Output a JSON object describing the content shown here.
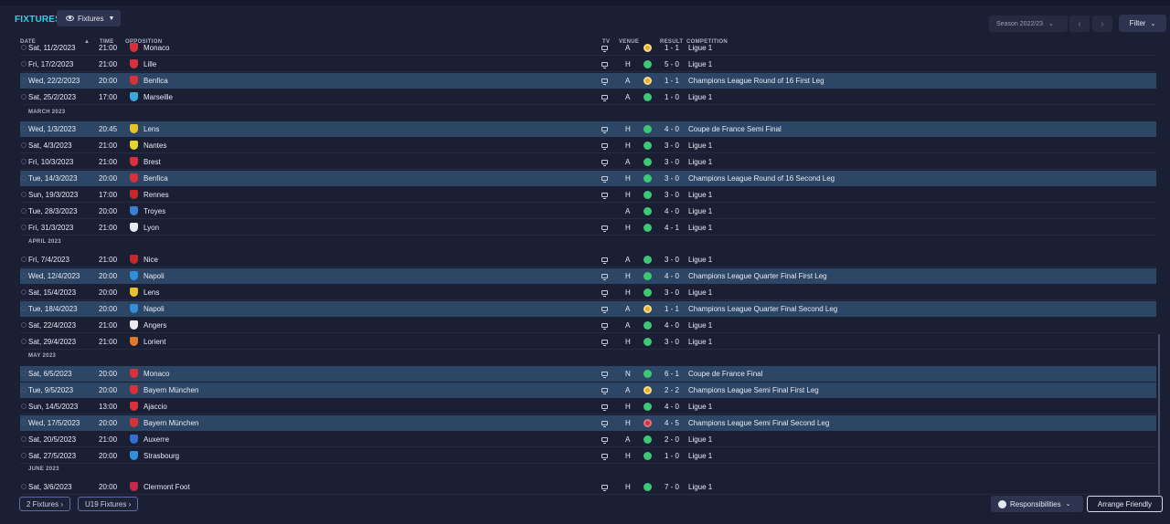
{
  "header": {
    "title": "FIXTURES",
    "view_dropdown": "Fixtures",
    "season": "Season 2022/23",
    "filter_label": "Filter"
  },
  "columns": {
    "date": "DATE",
    "time": "TIME",
    "opposition": "OPPOSITION",
    "tv": "TV",
    "venue": "VENUE",
    "result": "RESULT",
    "competition": "COMPETITION"
  },
  "icons": [
    "eye-icon",
    "chevron-down-icon",
    "chevron-left-icon",
    "chevron-right-icon",
    "sort-arrow-icon",
    "tv-icon",
    "result-dot-icon",
    "club-crest-icon",
    "responsibilities-icon"
  ],
  "colors": {
    "accent": "#2fd1e4",
    "win": "#3ec774",
    "draw": "#e7ad2b",
    "loss": "#c03c42",
    "highlight_row": "#2e4665"
  },
  "months": [
    "MARCH 2023",
    "APRIL 2023",
    "MAY 2023",
    "JUNE 2023"
  ],
  "fixtures": [
    {
      "date": "Sat, 11/2/2023",
      "time": "21:00",
      "opp": "Monaco",
      "crest": "#d8313a",
      "tv": true,
      "venue": "A",
      "result": "1 - 1",
      "outcome": "D",
      "comp": "Ligue 1",
      "hl": false
    },
    {
      "date": "Fri, 17/2/2023",
      "time": "21:00",
      "opp": "Lille",
      "crest": "#d8313a",
      "tv": true,
      "venue": "H",
      "result": "5 - 0",
      "outcome": "W",
      "comp": "Ligue 1",
      "hl": false
    },
    {
      "date": "Wed, 22/2/2023",
      "time": "20:00",
      "opp": "Benfica",
      "crest": "#d8313a",
      "tv": true,
      "venue": "A",
      "result": "1 - 1",
      "outcome": "D",
      "comp": "Champions League Round of 16  First Leg",
      "hl": true
    },
    {
      "date": "Sat, 25/2/2023",
      "time": "17:00",
      "opp": "Marseille",
      "crest": "#3aa7df",
      "tv": true,
      "venue": "A",
      "result": "1 - 0",
      "outcome": "W",
      "comp": "Ligue 1",
      "hl": false
    },
    {
      "date": "Wed, 1/3/2023",
      "time": "20:45",
      "opp": "Lens",
      "crest": "#e8c12b",
      "tv": true,
      "venue": "H",
      "result": "4 - 0",
      "outcome": "W",
      "comp": "Coupe de France Semi Final",
      "hl": true
    },
    {
      "date": "Sat, 4/3/2023",
      "time": "21:00",
      "opp": "Nantes",
      "crest": "#e8d52b",
      "tv": true,
      "venue": "H",
      "result": "3 - 0",
      "outcome": "W",
      "comp": "Ligue 1",
      "hl": false
    },
    {
      "date": "Fri, 10/3/2023",
      "time": "21:00",
      "opp": "Brest",
      "crest": "#d8313a",
      "tv": true,
      "venue": "A",
      "result": "3 - 0",
      "outcome": "W",
      "comp": "Ligue 1",
      "hl": false
    },
    {
      "date": "Tue, 14/3/2023",
      "time": "20:00",
      "opp": "Benfica",
      "crest": "#d8313a",
      "tv": true,
      "venue": "H",
      "result": "3 - 0",
      "outcome": "W",
      "comp": "Champions League Round of 16  Second Leg",
      "hl": true
    },
    {
      "date": "Sun, 19/3/2023",
      "time": "17:00",
      "opp": "Rennes",
      "crest": "#c42a2a",
      "tv": true,
      "venue": "H",
      "result": "3 - 0",
      "outcome": "W",
      "comp": "Ligue 1",
      "hl": false
    },
    {
      "date": "Tue, 28/3/2023",
      "time": "20:00",
      "opp": "Troyes",
      "crest": "#3a7fd0",
      "tv": false,
      "venue": "A",
      "result": "4 - 0",
      "outcome": "W",
      "comp": "Ligue 1",
      "hl": false
    },
    {
      "date": "Fri, 31/3/2023",
      "time": "21:00",
      "opp": "Lyon",
      "crest": "#e9eaf0",
      "tv": true,
      "venue": "H",
      "result": "4 - 1",
      "outcome": "W",
      "comp": "Ligue 1",
      "hl": false
    },
    {
      "date": "Fri, 7/4/2023",
      "time": "21:00",
      "opp": "Nice",
      "crest": "#c42a2a",
      "tv": true,
      "venue": "A",
      "result": "3 - 0",
      "outcome": "W",
      "comp": "Ligue 1",
      "hl": false
    },
    {
      "date": "Wed, 12/4/2023",
      "time": "20:00",
      "opp": "Napoli",
      "crest": "#2f8fd9",
      "tv": true,
      "venue": "H",
      "result": "4 - 0",
      "outcome": "W",
      "comp": "Champions League Quarter Final First Leg",
      "hl": true
    },
    {
      "date": "Sat, 15/4/2023",
      "time": "20:00",
      "opp": "Lens",
      "crest": "#e8c12b",
      "tv": true,
      "venue": "H",
      "result": "3 - 0",
      "outcome": "W",
      "comp": "Ligue 1",
      "hl": false
    },
    {
      "date": "Tue, 18/4/2023",
      "time": "20:00",
      "opp": "Napoli",
      "crest": "#2f8fd9",
      "tv": true,
      "venue": "A",
      "result": "1 - 1",
      "outcome": "D",
      "comp": "Champions League Quarter Final Second Leg",
      "hl": true
    },
    {
      "date": "Sat, 22/4/2023",
      "time": "21:00",
      "opp": "Angers",
      "crest": "#e9eaf0",
      "tv": true,
      "venue": "A",
      "result": "4 - 0",
      "outcome": "W",
      "comp": "Ligue 1",
      "hl": false
    },
    {
      "date": "Sat, 29/4/2023",
      "time": "21:00",
      "opp": "Lorient",
      "crest": "#e07a2a",
      "tv": true,
      "venue": "H",
      "result": "3 - 0",
      "outcome": "W",
      "comp": "Ligue 1",
      "hl": false
    },
    {
      "date": "Sat, 6/5/2023",
      "time": "20:00",
      "opp": "Monaco",
      "crest": "#d8313a",
      "tv": true,
      "venue": "N",
      "result": "6 - 1",
      "outcome": "W",
      "comp": "Coupe de France Final",
      "hl": true
    },
    {
      "date": "Tue, 9/5/2023",
      "time": "20:00",
      "opp": "Bayern München",
      "crest": "#d8313a",
      "tv": true,
      "venue": "A",
      "result": "2 - 2",
      "outcome": "D",
      "comp": "Champions League Semi Final First Leg",
      "hl": true
    },
    {
      "date": "Sun, 14/5/2023",
      "time": "13:00",
      "opp": "Ajaccio",
      "crest": "#d8313a",
      "tv": true,
      "venue": "H",
      "result": "4 - 0",
      "outcome": "W",
      "comp": "Ligue 1",
      "hl": false
    },
    {
      "date": "Wed, 17/5/2023",
      "time": "20:00",
      "opp": "Bayern München",
      "crest": "#d8313a",
      "tv": true,
      "venue": "H",
      "result": "4 - 5",
      "outcome": "L",
      "comp": "Champions League Semi Final Second Leg",
      "hl": true
    },
    {
      "date": "Sat, 20/5/2023",
      "time": "21:00",
      "opp": "Auxerre",
      "crest": "#2f6fd0",
      "tv": true,
      "venue": "A",
      "result": "2 - 0",
      "outcome": "W",
      "comp": "Ligue 1",
      "hl": false
    },
    {
      "date": "Sat, 27/5/2023",
      "time": "20:00",
      "opp": "Strasbourg",
      "crest": "#2f8fd9",
      "tv": true,
      "venue": "H",
      "result": "1 - 0",
      "outcome": "W",
      "comp": "Ligue 1",
      "hl": false
    },
    {
      "date": "Sat, 3/6/2023",
      "time": "20:00",
      "opp": "Clermont Foot",
      "crest": "#c42a4a",
      "tv": true,
      "venue": "H",
      "result": "7 - 0",
      "outcome": "W",
      "comp": "Ligue 1",
      "hl": false
    }
  ],
  "footer": {
    "fixtures_btn": "2 Fixtures",
    "u19_btn": "U19 Fixtures",
    "responsibilities": "Responsibilities",
    "arrange_friendly": "Arrange Friendly"
  }
}
